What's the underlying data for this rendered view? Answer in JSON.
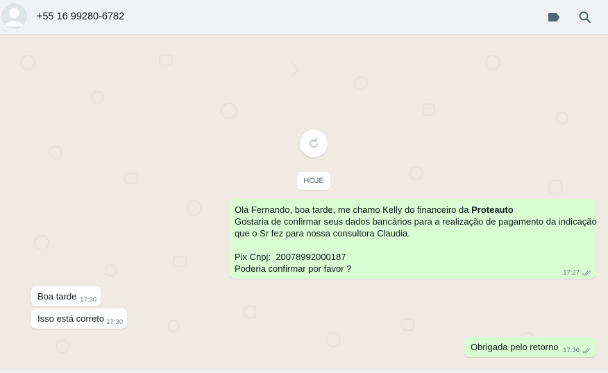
{
  "header": {
    "contact": "+55 16 99280-6782"
  },
  "chat": {
    "date_label": "HOJE",
    "messages": [
      {
        "direction": "out",
        "lines": [
          {
            "prefix": "Olá Fernando, boa tarde, me chamo Kelly do financeiro da ",
            "bold": "Proteauto"
          },
          {
            "text": "Gostaria de confirmar seus dados bancários para a realização de pagamento da indicação"
          },
          {
            "text": "que o Sr fez para nossa consultora Claudia."
          },
          {
            "text": ""
          },
          {
            "text": "Pix Cnpj:  20078992000187"
          },
          {
            "text": "Poderia confirmar por favor ?"
          }
        ],
        "time": "17:27"
      },
      {
        "direction": "in",
        "text": "Boa tarde",
        "time": "17:30"
      },
      {
        "direction": "in",
        "text": "Isso está correto",
        "time": "17:30"
      },
      {
        "direction": "out",
        "text": "Obrigada pelo retorno",
        "time": "17:30"
      }
    ]
  },
  "colors": {
    "outgoing_bubble": "#d9fdd3",
    "incoming_bubble": "#ffffff",
    "chat_background": "#efeae2",
    "read_ticks": "#8696a0"
  },
  "icons": {
    "avatar": "default-user-avatar-icon",
    "labels": "tag-icon",
    "search": "search-icon",
    "refresh": "refresh-icon",
    "read_receipt": "double-check-icon"
  }
}
